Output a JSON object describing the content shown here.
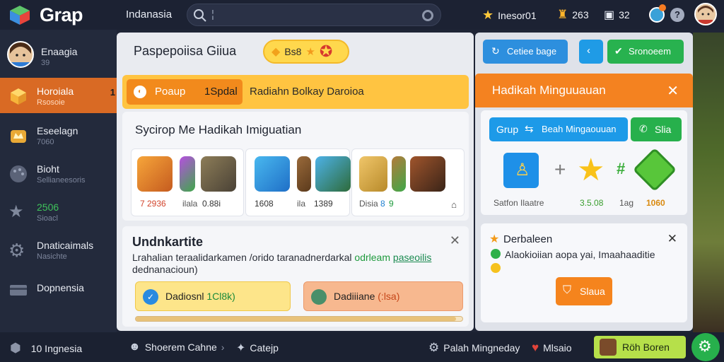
{
  "topbar": {
    "brand": "Grap",
    "region": "Indanasia",
    "search_caret": "¦",
    "stats": [
      {
        "icon": "star-icon",
        "value": "Inesor01"
      },
      {
        "icon": "trophy-icon",
        "value": "263"
      },
      {
        "icon": "gift-icon",
        "value": "32"
      }
    ]
  },
  "sidebar": {
    "profile": {
      "name": "Enaagia",
      "sub": "39"
    },
    "items": [
      {
        "label": "Horoiala",
        "sub": "Rsosoie",
        "badge": "1",
        "icon": "cube-icon"
      },
      {
        "label": "Eseelagn",
        "sub": "7060",
        "icon": "crown-icon"
      },
      {
        "label": "Bioht",
        "sub": "Sellianeesoris",
        "icon": "palette-icon"
      },
      {
        "label": "2506",
        "sub": "Sioacl",
        "icon": "star-icon"
      },
      {
        "label": "Dnaticaimals",
        "sub": "Nasichte",
        "icon": "gear-icon"
      },
      {
        "label": "Dopnensia",
        "sub": "",
        "icon": "card-icon"
      }
    ]
  },
  "main": {
    "title": "Paspepoiisa Giiua",
    "coin_label": "Bs8",
    "orange_btn_left": "Poaup",
    "orange_btn_right": "1Spdal",
    "orange_text": "Radiahn Bolkay Daroioa",
    "card1_title": "Sycirop Me Hadikah Imiguatian",
    "games": [
      {
        "s1": "7 2936",
        "s2": "ilala",
        "s3": "0.88i"
      },
      {
        "s1": "1608",
        "s2": "ila",
        "s3": "1389"
      },
      {
        "s1": "Disia",
        "s2": "8",
        "s3": "9"
      }
    ],
    "card2_title": "Undnkartite",
    "card2_desc_a": "Lrahalian teraalidarkamen /orido taranadnerdarkal",
    "card2_desc_link1": "odrleam",
    "card2_desc_link2": "paseoilis",
    "card2_desc_b": "dednanacioun)",
    "yellow_btn_label": "Dadiosnl",
    "yellow_btn_num": "1Cl8k)",
    "peach_btn_label": "Dadiiiane",
    "peach_btn_num": "(:lsa)",
    "progress": 0.98
  },
  "right": {
    "btn_top1": "Cetiee bage",
    "btn_top2": "Sronoeem",
    "head_title": "Hadikah Minguuauan",
    "blue_btn_a": "Grup",
    "blue_btn_b": "Beah Mingaouuan",
    "green_btn": "Slia",
    "stats": [
      "Satfon Ilaatre",
      "3.5.08",
      "1ag",
      "1060"
    ],
    "card2_title": "Derbaleen",
    "card2_text": "Alaokioiian aopa yai, Imaahaaditie",
    "card2_btn": "Slaua"
  },
  "bottombar": {
    "left": "10 Ingnesia",
    "b1": "Shoerem Cahne",
    "b2": "Catejp",
    "b3": "Palah Mingneday",
    "b4": "Mlsaio",
    "b5": "Röh Boren"
  },
  "colors": {
    "accent_orange": "#f48220",
    "accent_green": "#27b04c",
    "accent_blue": "#1d9ae8",
    "sidebar_active": "#d96a24"
  }
}
